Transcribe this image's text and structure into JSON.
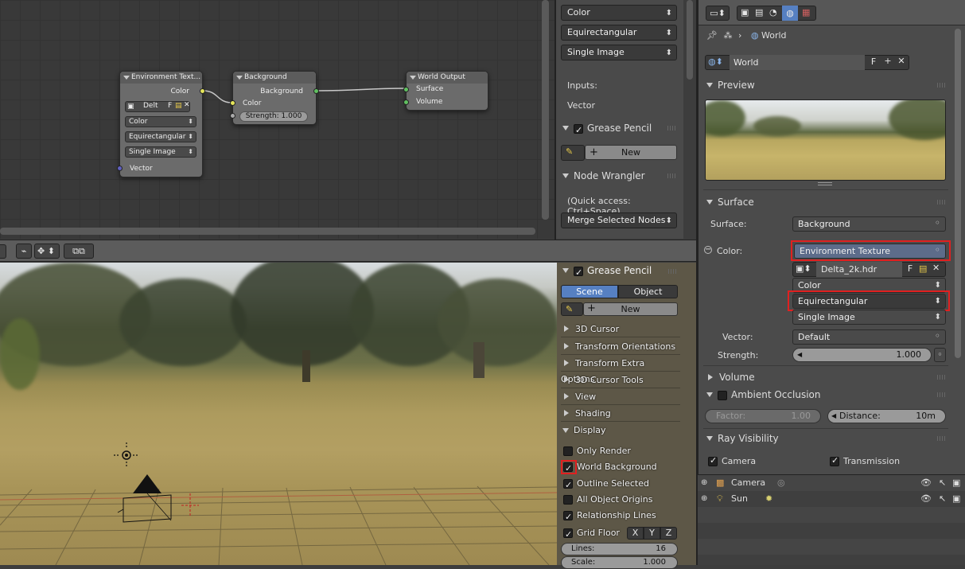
{
  "node_editor": {
    "env_node": {
      "title": "Environment Text...",
      "out_color": "Color",
      "image_name": "Delt",
      "fake_user": "F",
      "color_space": "Color",
      "projection": "Equirectangular",
      "source": "Single Image",
      "in_vector": "Vector"
    },
    "bg_node": {
      "title": "Background",
      "out_background": "Background",
      "in_color": "Color",
      "strength": "Strength:",
      "strength_value": "1.000"
    },
    "out_node": {
      "title": "World Output",
      "in_surface": "Surface",
      "in_volume": "Volume"
    }
  },
  "node_side": {
    "dd1": "Color",
    "dd2": "Equirectangular",
    "dd3": "Single Image",
    "inputs": "Inputs:",
    "vector": "Vector",
    "grease_pencil": "Grease Pencil",
    "new": "New",
    "node_wrangler": "Node Wrangler",
    "quick_access": "(Quick access: Ctrl+Space)",
    "merge": "Merge Selected Nodes"
  },
  "view_side": {
    "grease_pencil": "Grease Pencil",
    "scene": "Scene",
    "object": "Object",
    "new": "New",
    "sections": [
      "3D Cursor",
      "Transform Orientations",
      "Transform Extra Options",
      "3D Cursor Tools",
      "View",
      "Shading"
    ],
    "display": "Display",
    "options": [
      {
        "label": "Only Render",
        "checked": false
      },
      {
        "label": "World Background",
        "checked": true
      },
      {
        "label": "Outline Selected",
        "checked": true
      },
      {
        "label": "All Object Origins",
        "checked": false
      },
      {
        "label": "Relationship Lines",
        "checked": true
      },
      {
        "label": "Grid Floor",
        "checked": true
      }
    ],
    "axis_x": "X",
    "axis_y": "Y",
    "axis_z": "Z",
    "lines_label": "Lines:",
    "lines_value": "16",
    "scale_label": "Scale:",
    "scale_value": "1.000"
  },
  "props": {
    "breadcrumb": "World",
    "world_name": "World",
    "fake_user": "F",
    "preview": "Preview",
    "surface": "Surface",
    "surface_label": "Surface:",
    "surface_value": "Background",
    "color_label": "Color:",
    "color_value": "Environment Texture",
    "image_name": "Delta_2k.hdr",
    "image_f": "F",
    "color_space": "Color",
    "projection": "Equirectangular",
    "source": "Single Image",
    "vector_label": "Vector:",
    "vector_value": "Default",
    "strength_label": "Strength:",
    "strength_value": "1.000",
    "volume": "Volume",
    "ambient_occlusion": "Ambient Occlusion",
    "factor_label": "Factor:",
    "factor_value": "1.00",
    "distance_label": "Distance:",
    "distance_value": "10m",
    "ray_visibility": "Ray Visibility",
    "camera": "Camera",
    "transmission": "Transmission"
  },
  "outliner": {
    "items": [
      {
        "name": "Camera"
      },
      {
        "name": "Sun"
      }
    ]
  }
}
